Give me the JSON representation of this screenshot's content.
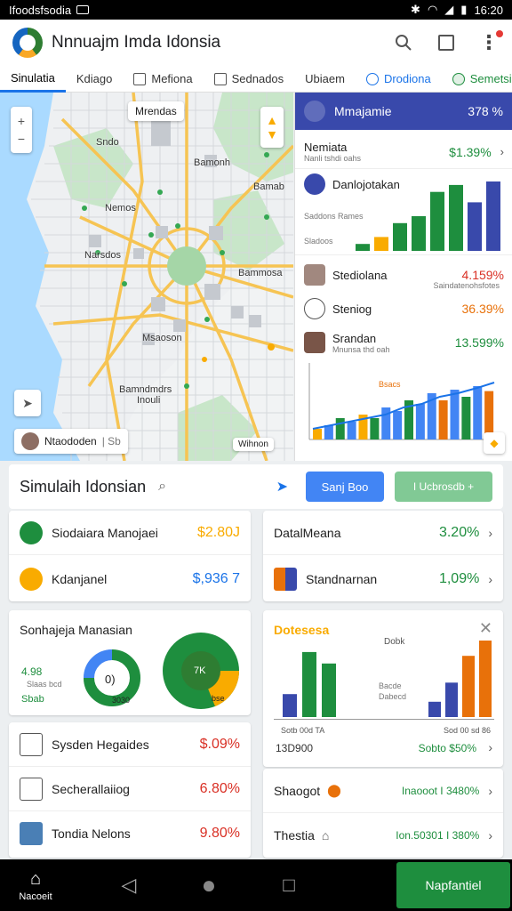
{
  "status": {
    "left_text": "Ifoodsfsodia",
    "time": "16:20"
  },
  "header": {
    "title": "Nnnuajm Imda Idonsia"
  },
  "tabs": [
    {
      "label": "Sinulatia"
    },
    {
      "label": "Kdiago"
    },
    {
      "label": "Mefiona"
    },
    {
      "label": "Sednados"
    },
    {
      "label": "Ubiaem"
    },
    {
      "label": "Drodiona"
    },
    {
      "label": "Semetsian"
    }
  ],
  "map": {
    "top_label": "Mrendas",
    "labels": [
      "Sndo",
      "Bamonh",
      "Bamab",
      "Nemos",
      "Narsdos",
      "Bammosa",
      "Msaoson",
      "Bamndmdrs",
      "Inouli",
      "Wihnon"
    ],
    "chip_label": "Ntaododen",
    "chip_meta": "| Sb"
  },
  "right_panel": {
    "head_title": "Mmajamie",
    "head_value": "378 %",
    "row1_title": "Nemiata",
    "row1_sub": "Nanli tshdi oahs",
    "row1_value": "$1.39%",
    "row2_title": "Danlojotakan",
    "row2_sub": "Saddons Rames",
    "row2_sub2": "Sladoos",
    "row3_title": "Stediolana",
    "row3_sub": "Saindatenohsfotes",
    "row3_value": "4.159%",
    "row4_title": "Steniog",
    "row4_value": "36.39%",
    "row5_title": "Srandan",
    "row5_sub": "Mnunsa thd oah",
    "row5_value": "13.599%",
    "chart_note": "Bsacs"
  },
  "midbar": {
    "title": "Simulaih Idonsian",
    "btn_blue": "Sanj Boo",
    "btn_green": "I Ucbrosdb +"
  },
  "left_cards": [
    {
      "label": "Siodaiara Manojaei",
      "value": "$2.80J"
    },
    {
      "label": "Kdanjanel",
      "value": "$,936 7"
    }
  ],
  "right_cards": [
    {
      "label": "DatalMeana",
      "value": "3.20%"
    },
    {
      "label": "Standnarnan",
      "value": "1,09%"
    }
  ],
  "donut_card": {
    "title": "Sonhajeja Manasian",
    "legend_value": "4.98",
    "legend_sub": "Slaas bcd",
    "legend_total": "Sbab",
    "center": "0)",
    "sub": "3030",
    "big_center": "7K",
    "big_sub": "bse"
  },
  "bar_card": {
    "title": "Dotesesa",
    "subtitle": "Dobk",
    "mid_label": "Bacde",
    "mid_sub": "Dabecd",
    "foot_left": "Sotb 00d TA",
    "foot_right": "Sod 00 sd 86",
    "val_left": "13D900",
    "val_right": "Sobto $50%"
  },
  "left_list": [
    {
      "label": "Sysden Hegaides",
      "value": "$.09%"
    },
    {
      "label": "Secherallaiiog",
      "value": "6.80%"
    },
    {
      "label": "Tondia Nelons",
      "value": "9.80%"
    }
  ],
  "right_list": [
    {
      "label": "Shaogot",
      "value": "Inaooot I 3480%"
    },
    {
      "label": "Thestia",
      "value": "Ion.50301 I 380%"
    }
  ],
  "nav": {
    "home_label": "Nacoeit",
    "cta": "Napfantiel"
  },
  "chart_data": [
    {
      "type": "bar",
      "series": [
        {
          "values": [
            0.1,
            0.2,
            0.4,
            0.5,
            0.85,
            0.95,
            0.7,
            1.0
          ]
        }
      ],
      "colors": [
        "#1e8e3e",
        "#f9ab00",
        "#1e8e3e",
        "#1e8e3e",
        "#1e8e3e",
        "#1e8e3e",
        "#3949ab",
        "#3949ab"
      ]
    },
    {
      "type": "bar",
      "series": [
        {
          "values": [
            0.15,
            0.2,
            0.3,
            0.25,
            0.35,
            0.3,
            0.45,
            0.4,
            0.55,
            0.5,
            0.65,
            0.55,
            0.7,
            0.6,
            0.75,
            0.68
          ]
        }
      ],
      "overlay_line": [
        0.15,
        0.2,
        0.25,
        0.3,
        0.35,
        0.45,
        0.5,
        0.6,
        0.65,
        0.72,
        0.8
      ]
    },
    {
      "type": "pie",
      "values": [
        75,
        25
      ]
    },
    {
      "type": "bar",
      "series": [
        {
          "values": [
            0.3,
            0.85,
            0.7
          ]
        }
      ],
      "colors": [
        "#3949ab",
        "#1e8e3e",
        "#1e8e3e"
      ]
    },
    {
      "type": "bar",
      "series": [
        {
          "values": [
            0.2,
            0.45,
            0.8,
            1.0
          ]
        }
      ],
      "colors": [
        "#3949ab",
        "#3949ab",
        "#e8710a",
        "#e8710a"
      ]
    }
  ]
}
